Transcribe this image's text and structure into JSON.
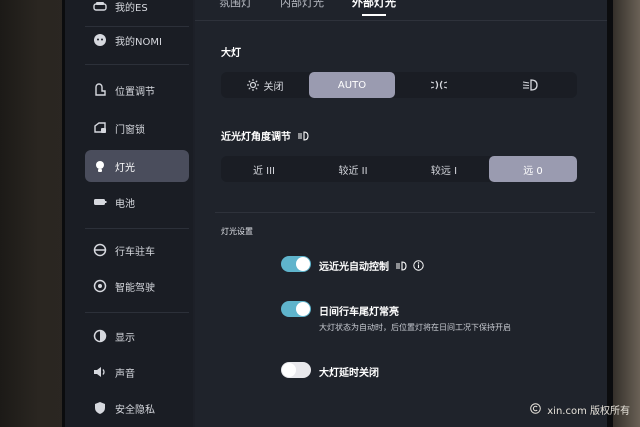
{
  "sidebar": {
    "items": [
      {
        "label": "我的ES"
      },
      {
        "label": "我的NOMI"
      },
      {
        "label": "位置调节"
      },
      {
        "label": "门窗锁"
      },
      {
        "label": "灯光"
      },
      {
        "label": "电池"
      },
      {
        "label": "行车驻车"
      },
      {
        "label": "智能驾驶"
      },
      {
        "label": "显示"
      },
      {
        "label": "声音"
      },
      {
        "label": "安全隐私"
      }
    ],
    "active_index": 4
  },
  "tabs": [
    {
      "label": "氛围灯"
    },
    {
      "label": "内部灯光"
    },
    {
      "label": "外部灯光"
    }
  ],
  "headlights": {
    "title": "大灯",
    "options": [
      {
        "label": "关闭",
        "icon": "sun-icon"
      },
      {
        "label": "AUTO"
      },
      {
        "label": "",
        "icon": "parking-light-icon"
      },
      {
        "label": "",
        "icon": "low-beam-icon"
      }
    ],
    "selected": "AUTO"
  },
  "beam_angle": {
    "title": "近光灯角度调节",
    "options": [
      {
        "label": "近 III"
      },
      {
        "label": "较近 II"
      },
      {
        "label": "较远 I"
      },
      {
        "label": "远 0"
      }
    ],
    "selected": "远 0"
  },
  "light_settings": {
    "section_title": "灯光设置",
    "rows": [
      {
        "title": "远近光自动控制",
        "enabled": true
      },
      {
        "title": "日间行车尾灯常亮",
        "desc": "大灯状态为自动时，后位置灯将在日间工况下保持开启",
        "enabled": true
      },
      {
        "title": "大灯延时关闭",
        "enabled": false
      }
    ]
  },
  "watermark": {
    "text": "xin.com 版权所有"
  },
  "colors": {
    "accent": "#5fb4cc",
    "selected_segment": "#9a9bb0",
    "active_sidebar": "#4a4d5c"
  }
}
